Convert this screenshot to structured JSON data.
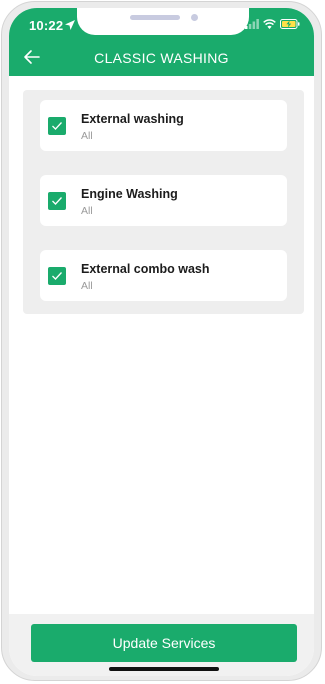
{
  "status_bar": {
    "time": "10:22"
  },
  "app_bar": {
    "title": "CLASSIC WASHING"
  },
  "services": [
    {
      "name": "External washing",
      "subtitle": "All",
      "checked": true
    },
    {
      "name": "Engine Washing",
      "subtitle": "All",
      "checked": true
    },
    {
      "name": "External combo wash",
      "subtitle": "All",
      "checked": true
    }
  ],
  "footer": {
    "update_label": "Update Services"
  },
  "colors": {
    "accent": "#1aab6c",
    "content_bg": "#eeeeee",
    "card_bg": "#ffffff"
  }
}
